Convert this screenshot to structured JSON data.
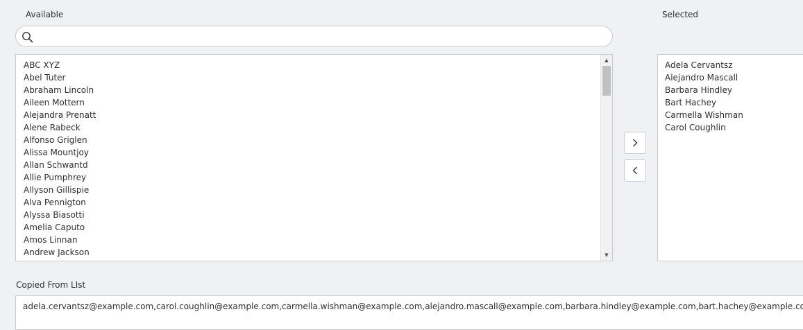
{
  "available": {
    "label": "Available",
    "search": {
      "value": "",
      "placeholder": ""
    },
    "items": [
      "ABC XYZ",
      "Abel Tuter",
      "Abraham Lincoln",
      "Aileen Mottern",
      "Alejandra Prenatt",
      "Alene Rabeck",
      "Alfonso Griglen",
      "Alissa Mountjoy",
      "Allan Schwantd",
      "Allie Pumphrey",
      "Allyson Gillispie",
      "Alva Pennigton",
      "Alyssa Biasotti",
      "Amelia Caputo",
      "Amos Linnan",
      "Andrew Jackson"
    ],
    "scroll_fraction": 0
  },
  "selected": {
    "label": "Selected",
    "items": [
      "Adela Cervantsz",
      "Alejandro Mascall",
      "Barbara Hindley",
      "Bart Hachey",
      "Carmella Wishman",
      "Carol Coughlin"
    ]
  },
  "buttons": {
    "move_right_icon": "chevron-right-icon",
    "move_left_icon": "chevron-left-icon"
  },
  "copied": {
    "label": "Copied From LIst",
    "value": "adela.cervantsz@example.com,carol.coughlin@example.com,carmella.wishman@example.com,alejandro.mascall@example.com,barbara.hindley@example.com,bart.hachey@example.com"
  }
}
